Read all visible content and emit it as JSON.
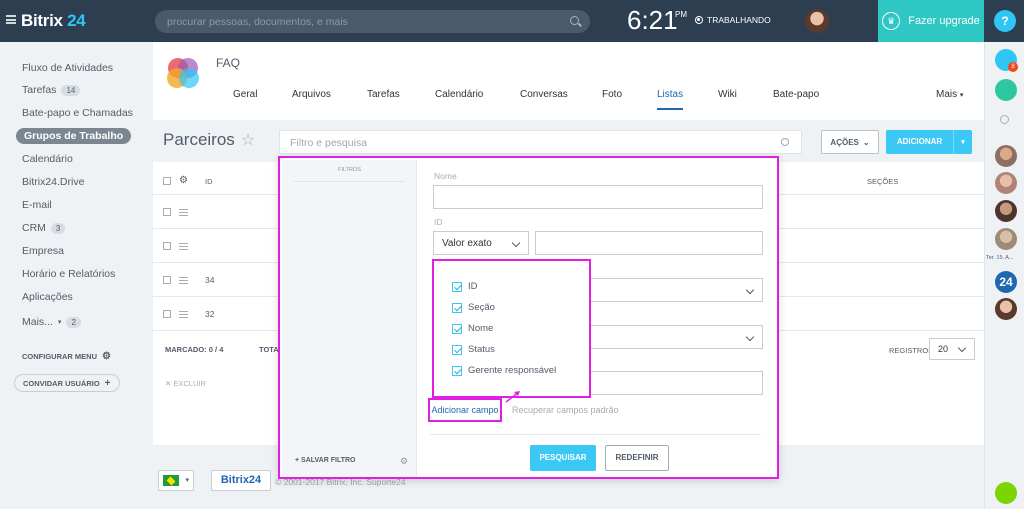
{
  "topbar": {
    "logo_a": "Bitrix",
    "logo_b": " 24",
    "search_placeholder": "procurar pessoas, documentos, e mais",
    "time": "6:21",
    "ampm": "PM",
    "status": "TRABALHANDO",
    "upgrade": "Fazer upgrade",
    "help": "?"
  },
  "leftnav": {
    "items": [
      {
        "label": "Fluxo de Atividades"
      },
      {
        "label": "Tarefas",
        "count": "14"
      },
      {
        "label": "Bate-papo e Chamadas"
      },
      {
        "label": "Grupos de Trabalho",
        "active": true
      },
      {
        "label": "Calendário"
      },
      {
        "label": "Bitrix24.Drive"
      },
      {
        "label": "E-mail"
      },
      {
        "label": "CRM",
        "count": "3"
      },
      {
        "label": "Empresa"
      },
      {
        "label": "Horário e Relatórios"
      },
      {
        "label": "Aplicações"
      },
      {
        "label": "Mais...",
        "count": "2"
      }
    ],
    "configure": "CONFIGURAR MENU",
    "invite": "CONVIDAR USUÁRIO"
  },
  "group": {
    "name": "FAQ",
    "tabs": [
      "Geral",
      "Arquivos",
      "Tarefas",
      "Calendário",
      "Conversas",
      "Foto",
      "Listas",
      "Wiki",
      "Bate-papo"
    ],
    "active_tab": "Listas",
    "more": "Mais"
  },
  "list": {
    "title": "Parceiros",
    "filter_placeholder": "Filtro e pesquisa",
    "actions": "AÇÕES",
    "add": "ADICIONAR"
  },
  "grid": {
    "col_id": "ID",
    "col_secoes": "SEÇÕES",
    "row_ids": [
      "",
      "",
      "34",
      "32"
    ],
    "marked_label": "MARCADO:",
    "marked_value": "0 / 4",
    "total_label": "TOTA",
    "records_label": "REGISTROS:",
    "records_value": "20",
    "delete": "EXCLUIR"
  },
  "footer": {
    "b24": "Bitrix24",
    "copyright": "© 2001-2017 Bitrix, Inc.",
    "support": "Suporte24"
  },
  "filter_popup": {
    "filters_label": "FILTROS",
    "save_filter": "SALVAR FILTRO",
    "name_label": "Nome",
    "id_label": "ID",
    "id_mode": "Valor exato",
    "field_options": [
      "ID",
      "Seção",
      "Nome",
      "Status",
      "Gerente responsável"
    ],
    "add_field": "Adicionar campo",
    "restore": "Recuperar campos padrão",
    "search_btn": "PESQUISAR",
    "reset_btn": "REDEFINIR"
  },
  "rightbar": {
    "notify_count": "8",
    "label_ter": "Ter. 15. A...",
    "b24": "24"
  }
}
